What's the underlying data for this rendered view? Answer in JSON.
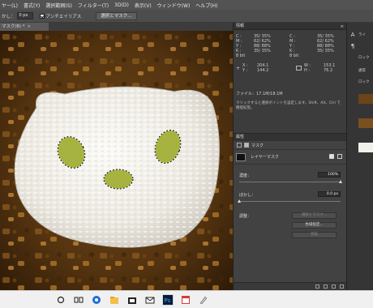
{
  "menubar": {
    "items": [
      "ヤー(L)",
      "書式(Y)",
      "選択範囲(S)",
      "フィルター(T)",
      "3D(D)",
      "表示(V)",
      "ウィンドウ(W)",
      "ヘルプ(H)"
    ]
  },
  "options": {
    "feather_label": "かし：",
    "feather_value": "0 px",
    "antialias_label": "アンチエイリアス",
    "select_mask_button": "選択とマスク..."
  },
  "document": {
    "tab_title": "マスク/8) *",
    "tab_close": "×"
  },
  "info_panel": {
    "title": "情報",
    "rows": [
      [
        "C :",
        "35/ 35%",
        "C :",
        "35/ 35%"
      ],
      [
        "M :",
        "62/ 62%",
        "M :",
        "62/ 62%"
      ],
      [
        "Y :",
        "88/ 88%",
        "Y :",
        "88/ 88%"
      ],
      [
        "K :",
        "35/ 35%",
        "K :",
        "35/ 35%"
      ],
      [
        "8 bit",
        "",
        "8 bit",
        ""
      ]
    ],
    "x_label": "X :",
    "x_value": "204.1",
    "y_label": "Y :",
    "y_value": "144.2",
    "w_label": "W :",
    "w_value": "153.1",
    "h_label": "H :",
    "h_value": "76.2",
    "file_info": "ファイル：17.1M/18.1M",
    "description": "クリックすると選択ポイントを設定します。Shift、Alt、Ctrl で機能拡張。"
  },
  "properties_panel": {
    "title": "属性",
    "mask_tab_label": "マスク",
    "layer_mask_label": "レイヤーマスク",
    "density_label": "濃度：",
    "density_value": "100%",
    "density_percent": 100,
    "feather_label": "ぼかし：",
    "feather_value": "0.0 px",
    "feather_percent": 0,
    "adjust_label": "調整：",
    "select_mask_button": "選択とマスク...",
    "color_range_button": "色域指定...",
    "invert_button": "反転"
  },
  "right_column": {
    "labels": [
      "ライ",
      "ロック",
      "通常",
      "ロック"
    ]
  },
  "taskbar": {
    "icons": [
      "search-icon",
      "task-view-icon",
      "edge-icon",
      "file-explorer-icon",
      "store-icon",
      "mail-icon",
      "photoshop-icon",
      "calendar-icon",
      "paint-icon"
    ]
  },
  "colors": {
    "app_bg": "#2b2b2b",
    "panel_bg": "#3c3c3c",
    "menubar_bg": "#535353",
    "curry_brown": "#5a3a14",
    "rice_white": "#f2f0ea",
    "veg_green": "#a7b340",
    "taskbar_bg": "#f0f0f0"
  }
}
